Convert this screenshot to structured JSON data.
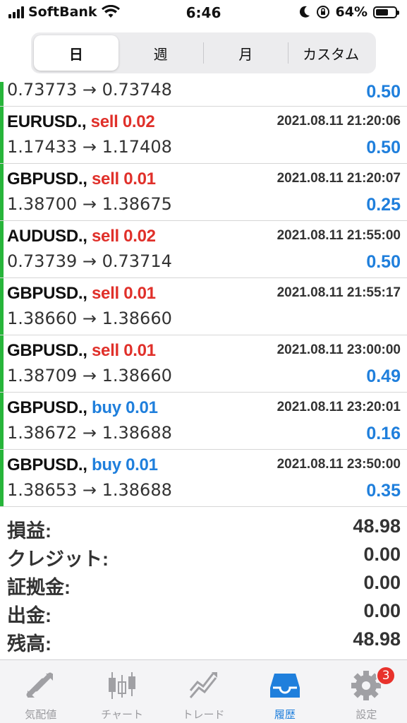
{
  "status_bar": {
    "carrier": "SoftBank",
    "time": "6:46",
    "battery": "64%",
    "battery_level": 0.64
  },
  "segments": {
    "items": [
      "日",
      "週",
      "月",
      "カスタム"
    ],
    "selected": "日"
  },
  "partial_row": {
    "prices": "0.73773 → 0.73748",
    "profit": "0.50"
  },
  "trades": [
    {
      "symbol": "EURUSD.,",
      "side": "sell",
      "volume": "sell 0.02",
      "datetime": "2021.08.11 21:20:06",
      "prices": "1.17433 → 1.17408",
      "profit": "0.50"
    },
    {
      "symbol": "GBPUSD.,",
      "side": "sell",
      "volume": "sell 0.01",
      "datetime": "2021.08.11 21:20:07",
      "prices": "1.38700 → 1.38675",
      "profit": "0.25"
    },
    {
      "symbol": "AUDUSD.,",
      "side": "sell",
      "volume": "sell 0.02",
      "datetime": "2021.08.11 21:55:00",
      "prices": "0.73739 → 0.73714",
      "profit": "0.50"
    },
    {
      "symbol": "GBPUSD.,",
      "side": "sell",
      "volume": "sell 0.01",
      "datetime": "2021.08.11 21:55:17",
      "prices": "1.38660 → 1.38660",
      "profit": ""
    },
    {
      "symbol": "GBPUSD.,",
      "side": "sell",
      "volume": "sell 0.01",
      "datetime": "2021.08.11 23:00:00",
      "prices": "1.38709 → 1.38660",
      "profit": "0.49"
    },
    {
      "symbol": "GBPUSD.,",
      "side": "buy",
      "volume": "buy 0.01",
      "datetime": "2021.08.11 23:20:01",
      "prices": "1.38672 → 1.38688",
      "profit": "0.16"
    },
    {
      "symbol": "GBPUSD.,",
      "side": "buy",
      "volume": "buy 0.01",
      "datetime": "2021.08.11 23:50:00",
      "prices": "1.38653 → 1.38688",
      "profit": "0.35"
    }
  ],
  "summary": [
    {
      "label": "損益:",
      "value": "48.98"
    },
    {
      "label": "クレジット:",
      "value": "0.00"
    },
    {
      "label": "証拠金:",
      "value": "0.00"
    },
    {
      "label": "出金:",
      "value": "0.00"
    },
    {
      "label": "残高:",
      "value": "48.98"
    }
  ],
  "tabs": [
    {
      "label": "気配値",
      "icon": "quotes-icon"
    },
    {
      "label": "チャート",
      "icon": "chart-icon"
    },
    {
      "label": "トレード",
      "icon": "trade-icon"
    },
    {
      "label": "履歴",
      "icon": "history-icon",
      "active": true
    },
    {
      "label": "設定",
      "icon": "settings-icon",
      "badge": "3"
    }
  ],
  "colors": {
    "sell": "#e0302a",
    "buy": "#1f7fdc",
    "profit": "#1f7fdc",
    "marker": "#27b53a"
  }
}
